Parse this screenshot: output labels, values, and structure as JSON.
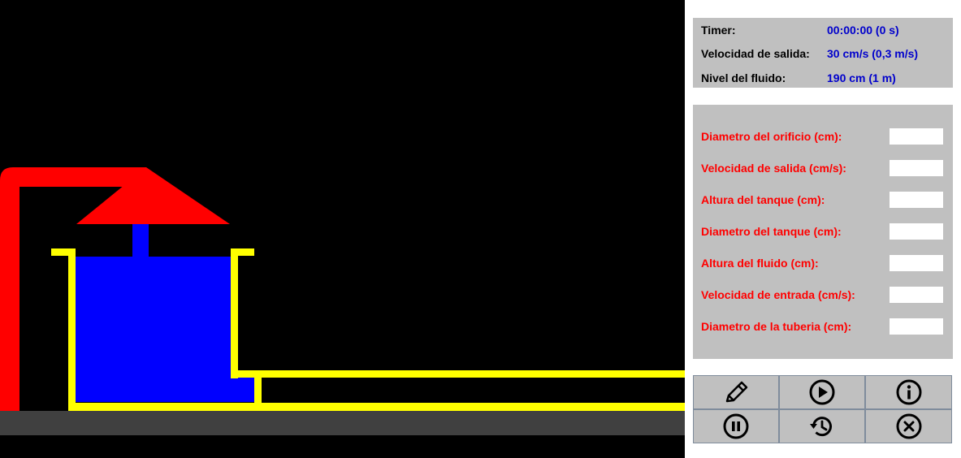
{
  "info": {
    "timer_label": "Timer:",
    "timer_value": "00:00:00 (0 s)",
    "exit_speed_label": "Velocidad de salida:",
    "exit_speed_value": "30 cm/s (0,3 m/s)",
    "fluid_level_label": "Nivel del fluido:",
    "fluid_level_value": "190 cm (1 m)"
  },
  "params": [
    {
      "label": "Diametro del orificio (cm):",
      "value": ""
    },
    {
      "label": "Velocidad de salida (cm/s):",
      "value": ""
    },
    {
      "label": "Altura del tanque (cm):",
      "value": ""
    },
    {
      "label": "Diametro del tanque (cm):",
      "value": ""
    },
    {
      "label": "Altura del fluido (cm):",
      "value": ""
    },
    {
      "label": "Velocidad de entrada (cm/s):",
      "value": ""
    },
    {
      "label": "Diametro de la tuberia (cm):",
      "value": ""
    }
  ],
  "buttons": [
    {
      "name": "edit",
      "icon": "pencil-icon"
    },
    {
      "name": "play",
      "icon": "play-icon"
    },
    {
      "name": "info",
      "icon": "info-icon"
    },
    {
      "name": "pause",
      "icon": "pause-icon"
    },
    {
      "name": "reset",
      "icon": "history-icon"
    },
    {
      "name": "close",
      "icon": "close-icon"
    }
  ],
  "colors": {
    "pipe_inlet": "#ff0000",
    "tank_wall": "#ffff00",
    "fluid": "#0000ff",
    "ground": "#404040",
    "canvas_bg": "#000000",
    "label_red": "#ff0000",
    "value_blue": "#0000cc"
  }
}
